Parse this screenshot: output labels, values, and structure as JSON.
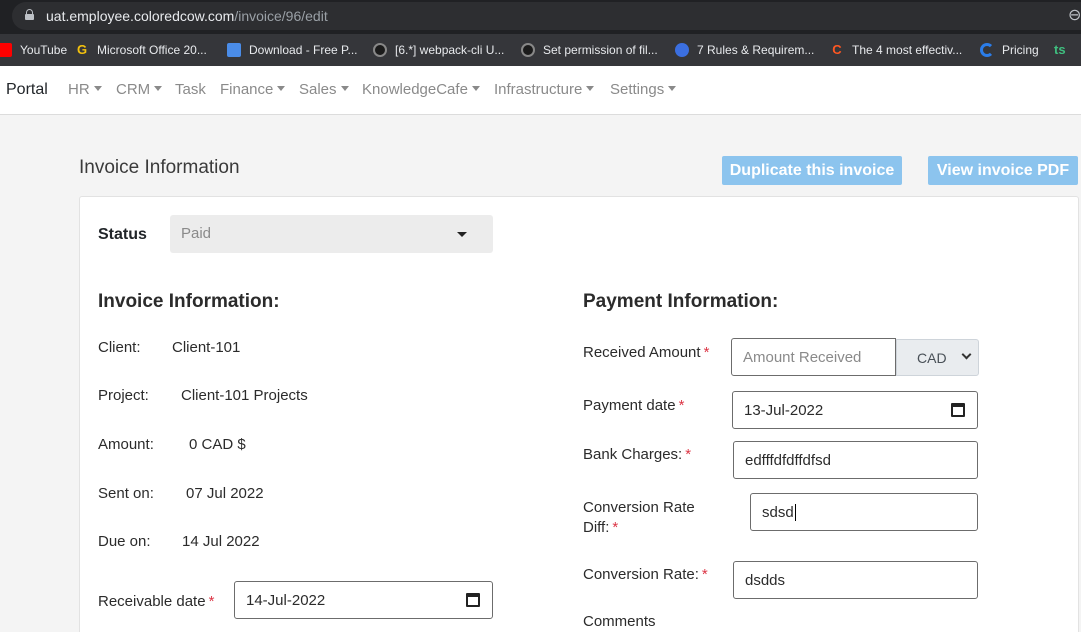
{
  "browser": {
    "url_host": "uat.employee.coloredcow.com",
    "url_path": "/invoice/96/edit",
    "bookmarks": [
      {
        "label": "YouTube",
        "icon": "youtube-icon"
      },
      {
        "label": "Microsoft Office 20...",
        "icon": "g-icon"
      },
      {
        "label": "Download - Free P...",
        "icon": "download-icon"
      },
      {
        "label": "[6.*] webpack-cli U...",
        "icon": "github-icon"
      },
      {
        "label": "Set permission of fil...",
        "icon": "github-icon"
      },
      {
        "label": "7 Rules & Requirem...",
        "icon": "seven-icon"
      },
      {
        "label": "The 4 most effectiv...",
        "icon": "c-icon"
      },
      {
        "label": "Pricing",
        "icon": "pricing-icon"
      },
      {
        "label": "ts",
        "icon": "ts-icon"
      }
    ]
  },
  "nav": {
    "brand": "Portal",
    "items": [
      "HR",
      "CRM",
      "Task",
      "Finance",
      "Sales",
      "KnowledgeCafe",
      "Infrastructure",
      "Settings"
    ]
  },
  "page": {
    "title": "Invoice Information",
    "duplicate_button": "Duplicate this invoice",
    "pdf_button": "View invoice PDF"
  },
  "status": {
    "label": "Status",
    "value": "Paid"
  },
  "invoice_info": {
    "heading": "Invoice Information:",
    "client_label": "Client:",
    "client_value": "Client-101",
    "project_label": "Project:",
    "project_value": "Client-101 Projects",
    "amount_label": "Amount:",
    "amount_value": "0 CAD $",
    "sent_label": "Sent on:",
    "sent_value": "07 Jul 2022",
    "due_label": "Due on:",
    "due_value": "14 Jul 2022",
    "receivable_label": "Receivable date",
    "receivable_value": "14-Jul-2022"
  },
  "payment_info": {
    "heading": "Payment Information:",
    "received_label": "Received Amount",
    "received_placeholder": "Amount Received",
    "currency": "CAD",
    "payment_date_label": "Payment date",
    "payment_date_value": "13-Jul-2022",
    "bank_charges_label": "Bank Charges:",
    "bank_charges_value": "edfffdfdffdfsd",
    "conversion_diff_label_1": "Conversion Rate",
    "conversion_diff_label_2": "Diff:",
    "conversion_diff_value": "sdsd",
    "conversion_rate_label": "Conversion Rate:",
    "conversion_rate_value": "dsdds",
    "comments_label": "Comments",
    "required_mark": "*"
  },
  "colors": {
    "button_bg": "#8cc4ee",
    "required": "#dc3545",
    "nav_text": "#8a8a8a"
  }
}
